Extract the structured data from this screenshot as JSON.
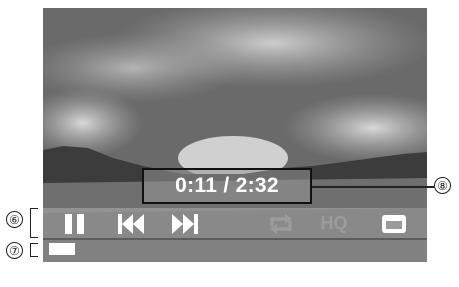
{
  "player": {
    "time_display": "0:11 / 2:32",
    "progress": 0.07,
    "buttons": {
      "pause": {
        "icon": "pause-icon"
      },
      "previous": {
        "icon": "skip-previous-icon"
      },
      "next": {
        "icon": "skip-next-icon"
      },
      "repeat": {
        "icon": "repeat-icon"
      },
      "hq": {
        "label": "HQ"
      },
      "mini": {
        "icon": "window-icon"
      }
    }
  },
  "callouts": {
    "controls": "⑥",
    "progress": "⑦",
    "time": "⑧"
  },
  "colors": {
    "control_bar": "#afafaf",
    "icon_active": "#ffffff",
    "icon_disabled": "#9c9c9c"
  }
}
